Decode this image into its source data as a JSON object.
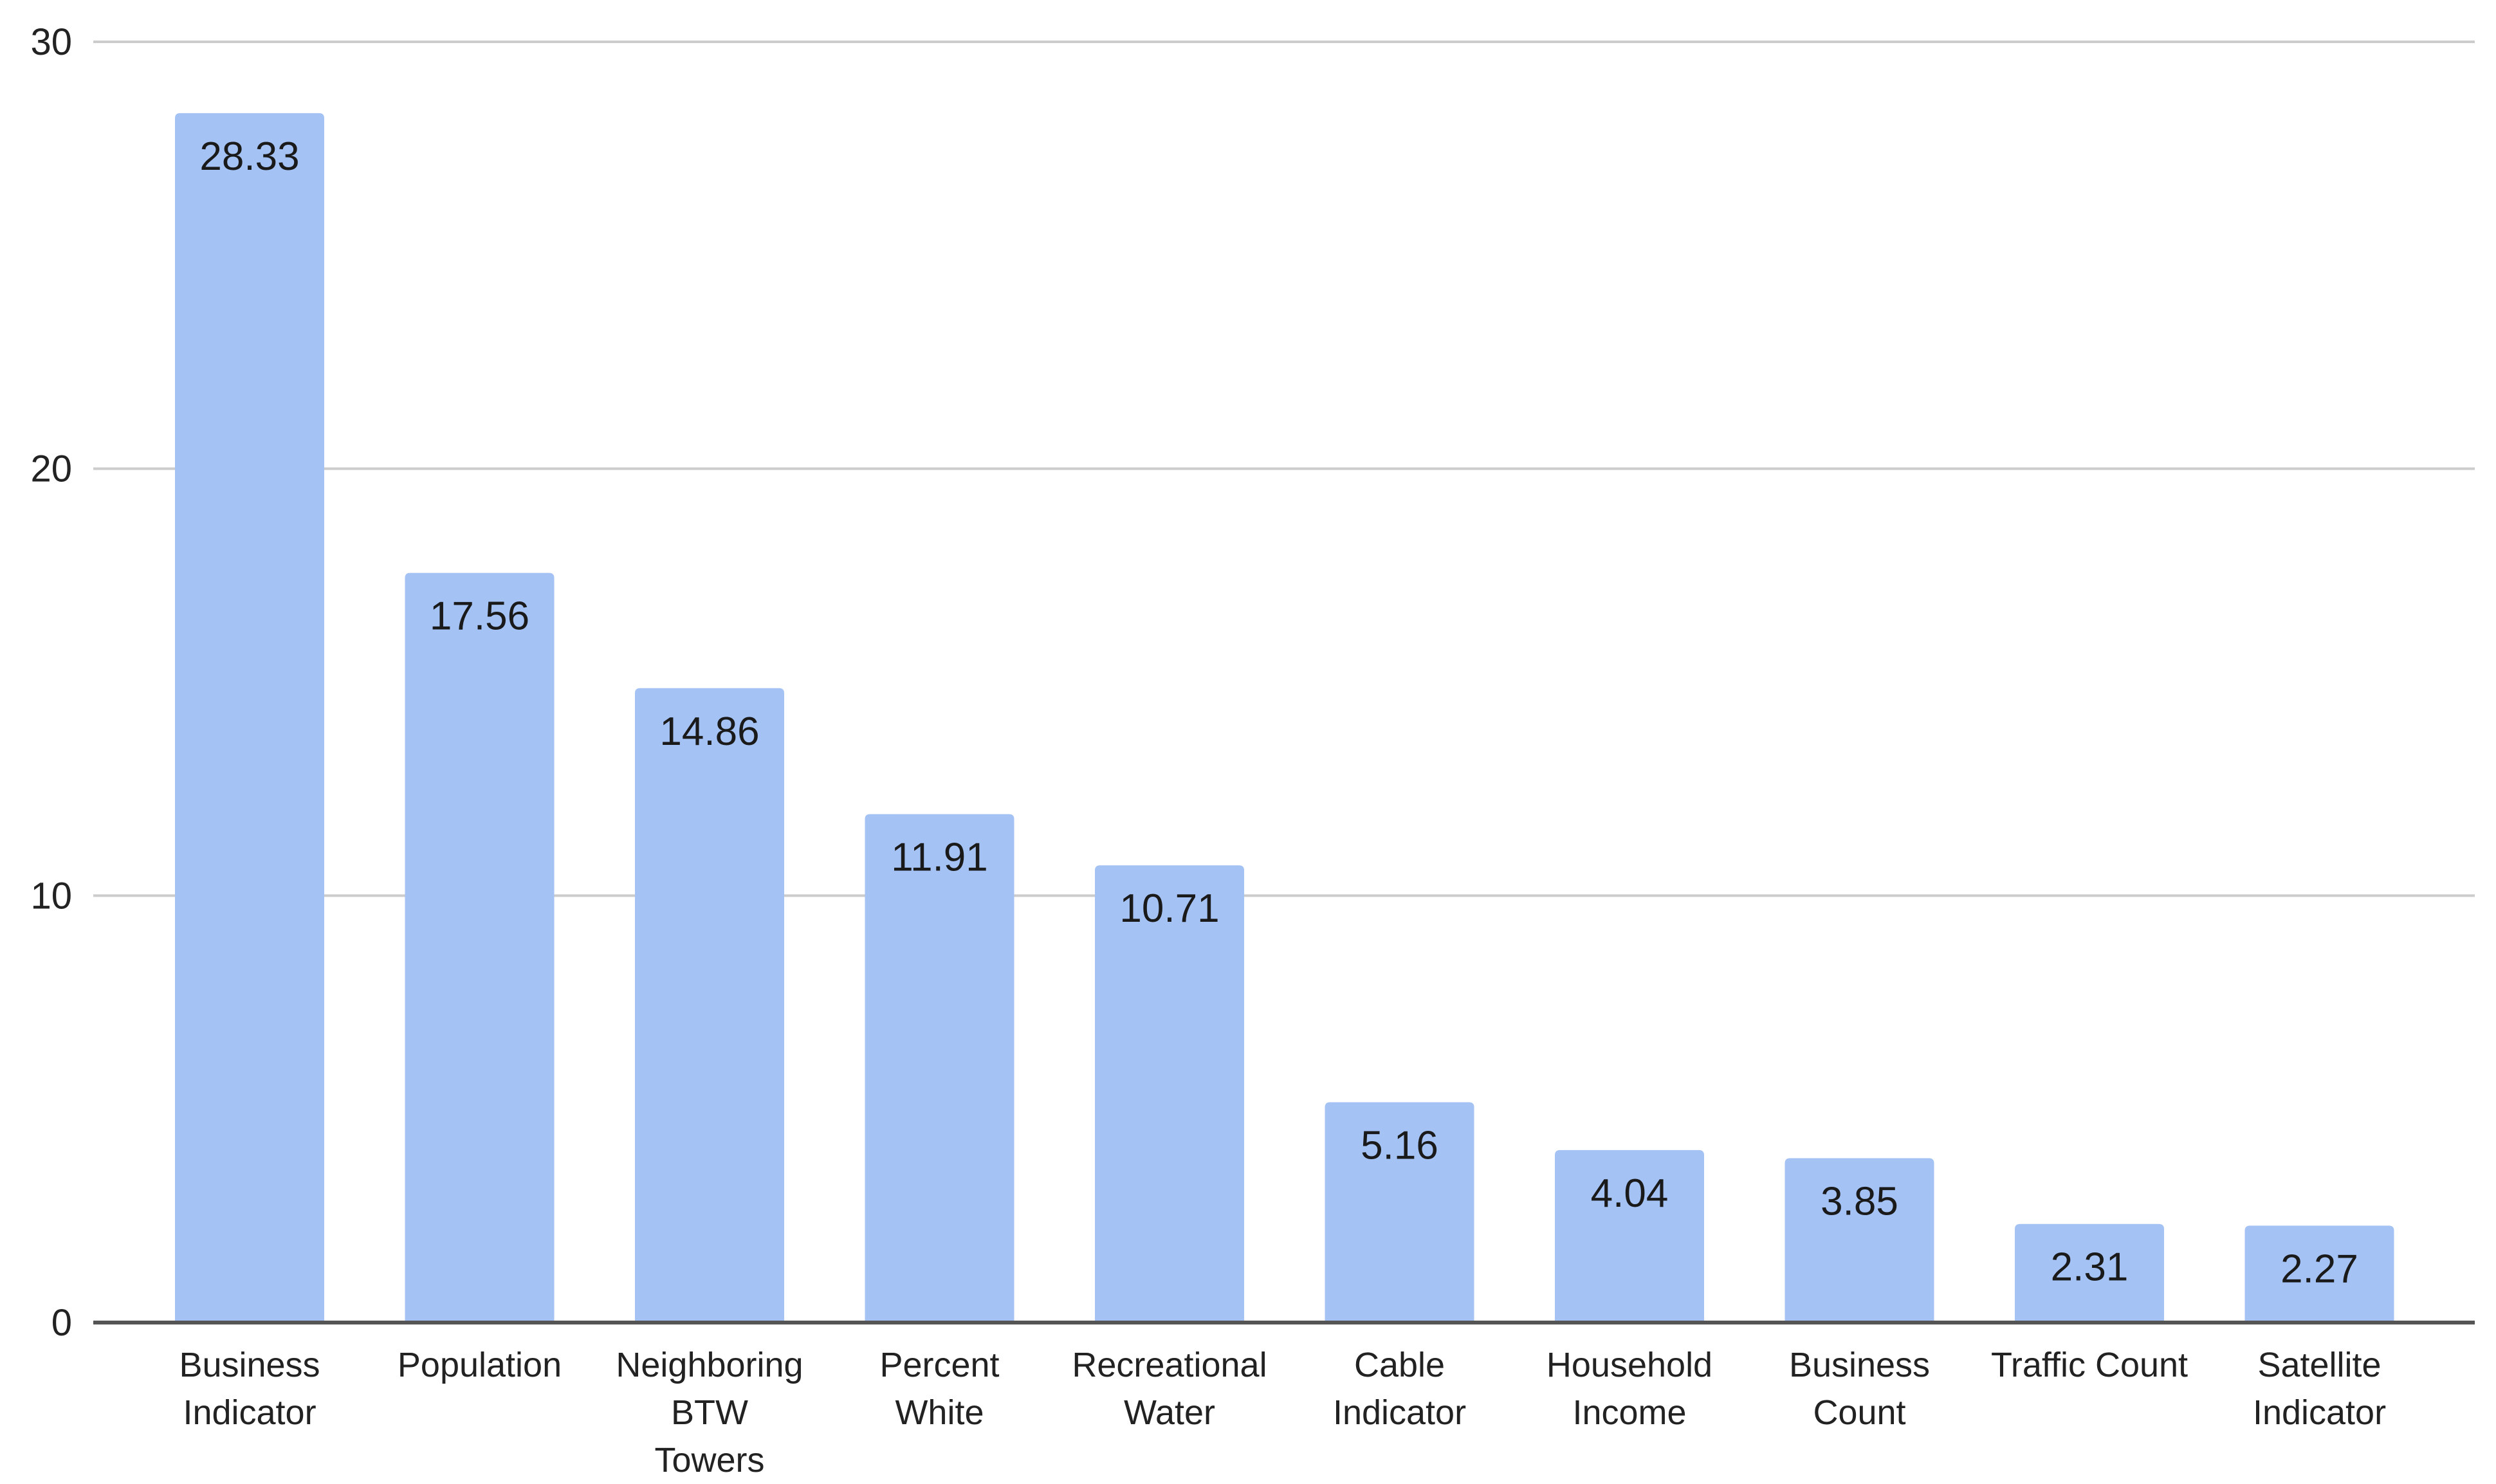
{
  "chart_data": {
    "type": "bar",
    "title": "",
    "xlabel": "",
    "ylabel": "",
    "ylim": [
      0,
      30
    ],
    "yticks": [
      0,
      10,
      20,
      30
    ],
    "grid": true,
    "legend": "none",
    "bar_color": "#a4c2f4",
    "categories": [
      [
        "Business",
        "Indicator"
      ],
      [
        "Population"
      ],
      [
        "Neighboring",
        "BTW",
        "Towers"
      ],
      [
        "Percent",
        "White"
      ],
      [
        "Recreational",
        "Water"
      ],
      [
        "Cable",
        "Indicator"
      ],
      [
        "Household",
        "Income"
      ],
      [
        "Business",
        "Count"
      ],
      [
        "Traffic Count"
      ],
      [
        "Satellite",
        "Indicator"
      ]
    ],
    "values": [
      28.33,
      17.56,
      14.86,
      11.91,
      10.71,
      5.16,
      4.04,
      3.85,
      2.31,
      2.27
    ],
    "data_labels": [
      "28.33",
      "17.56",
      "14.86",
      "11.91",
      "10.71",
      "5.16",
      "4.04",
      "3.85",
      "2.31",
      "2.27"
    ]
  }
}
